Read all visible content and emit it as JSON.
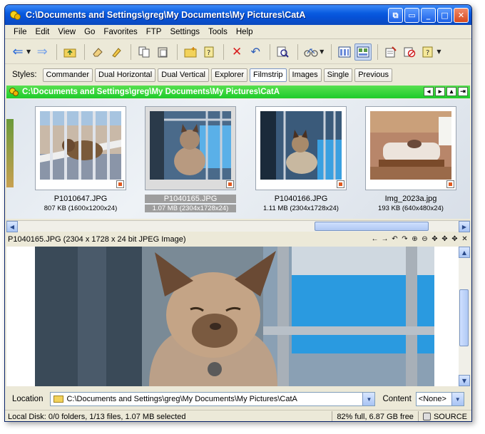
{
  "window": {
    "title": "C:\\Documents and Settings\\greg\\My Documents\\My Pictures\\CatA",
    "buttons": [
      "⧉",
      "▭",
      "_",
      "□",
      "✕"
    ]
  },
  "menu": [
    "File",
    "Edit",
    "View",
    "Go",
    "Favorites",
    "FTP",
    "Settings",
    "Tools",
    "Help"
  ],
  "styles": {
    "label": "Styles:",
    "buttons": [
      "Commander",
      "Dual Horizontal",
      "Dual Vertical",
      "Explorer",
      "Filmstrip",
      "Images",
      "Single",
      "Previous"
    ],
    "active": "Filmstrip"
  },
  "path": {
    "text": "C:\\Documents and Settings\\greg\\My Documents\\My Pictures\\CatA",
    "nav": [
      "◂",
      "▸",
      "▴",
      "⇥"
    ]
  },
  "thumbnails": [
    {
      "name": "P1010647.JPG",
      "info": "807 KB (1600x1200x24)"
    },
    {
      "name": "P1040165.JPG",
      "info": "1.07 MB (2304x1728x24)"
    },
    {
      "name": "P1040166.JPG",
      "info": "1.11 MB (2304x1728x24)"
    },
    {
      "name": "Img_2023a.jpg",
      "info": "193 KB (640x480x24)"
    }
  ],
  "viewer": {
    "info": "P1040165.JPG (2304 x 1728 x 24 bit JPEG Image)",
    "tools": [
      "←",
      "→",
      "↶",
      "↷",
      "⊕",
      "⊖",
      "✥",
      "✥",
      "✥",
      "✕"
    ]
  },
  "location": {
    "label": "Location",
    "value": "C:\\Documents and Settings\\greg\\My Documents\\My Pictures\\CatA",
    "content_label": "Content",
    "content_value": "<None>"
  },
  "status": {
    "left": "Local Disk: 0/0 folders, 1/13 files, 1.07 MB selected",
    "disk": "82% full, 6.87 GB free",
    "source": "SOURCE"
  },
  "colors": {
    "titlebar": "#0a5ce0",
    "pathbar": "#1ecb2a",
    "selection": "#9e9e9e"
  }
}
